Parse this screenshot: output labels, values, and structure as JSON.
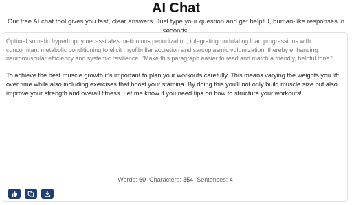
{
  "header": {
    "title": "AI Chat",
    "subtitle": "Our free AI chat tool gives you fast, clear answers. Just type your question and get helpful, human-like responses in seconds."
  },
  "chat": {
    "prompt": "Optimal somatic hypertrophy necessitates meticulous periodization, integrating undulating load progressions with concomitant metabolic conditioning to elicit myofibrillar accretion and sarcoplasmic volumization, thereby enhancing neuromuscular efficiency and systemic resilience. “Make this paragraph easier to read and match a friendly, helpful tone.”",
    "response": "To achieve the best muscle growth it's important to plan your workouts carefully. This means varying the weights you lift over time while also including exercises that boost your stamina. By doing this you'll not only build muscle size but also improve your strength and overall fitness. Let me know if you need tips on how to structure your workouts!"
  },
  "stats": {
    "words_label": "Words:",
    "words_value": "60",
    "characters_label": "Characters:",
    "characters_value": "354",
    "sentences_label": "Sentences:",
    "sentences_value": "4"
  },
  "actions": {
    "icons": [
      "thumbs-up-icon",
      "copy-icon",
      "download-icon"
    ],
    "button_color": "#1f3f73"
  }
}
